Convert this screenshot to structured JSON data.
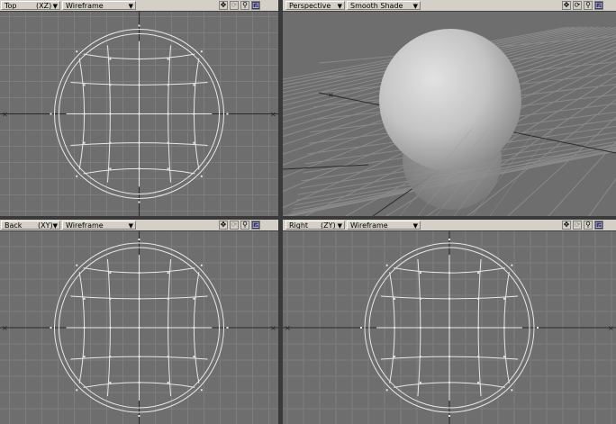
{
  "viewports": [
    {
      "id": "top",
      "view_label": "Top",
      "axis_label": "(XZ)",
      "mode_label": "Wireframe"
    },
    {
      "id": "perspective",
      "view_label": "Perspective",
      "axis_label": "",
      "mode_label": "Smooth Shade"
    },
    {
      "id": "back",
      "view_label": "Back",
      "axis_label": "(XY)",
      "mode_label": "Wireframe"
    },
    {
      "id": "right",
      "view_label": "Right",
      "axis_label": "(ZY)",
      "mode_label": "Wireframe"
    }
  ],
  "icons": [
    "move-view-icon",
    "rotate-view-icon",
    "zoom-view-icon",
    "maximize-view-icon"
  ],
  "colors": {
    "viewport_bg": "#6e6e6e",
    "grid": "#7d7d7d",
    "wire": "#e8e8e8",
    "axis": "#2a2a2a",
    "header": "#d4d0c8"
  }
}
